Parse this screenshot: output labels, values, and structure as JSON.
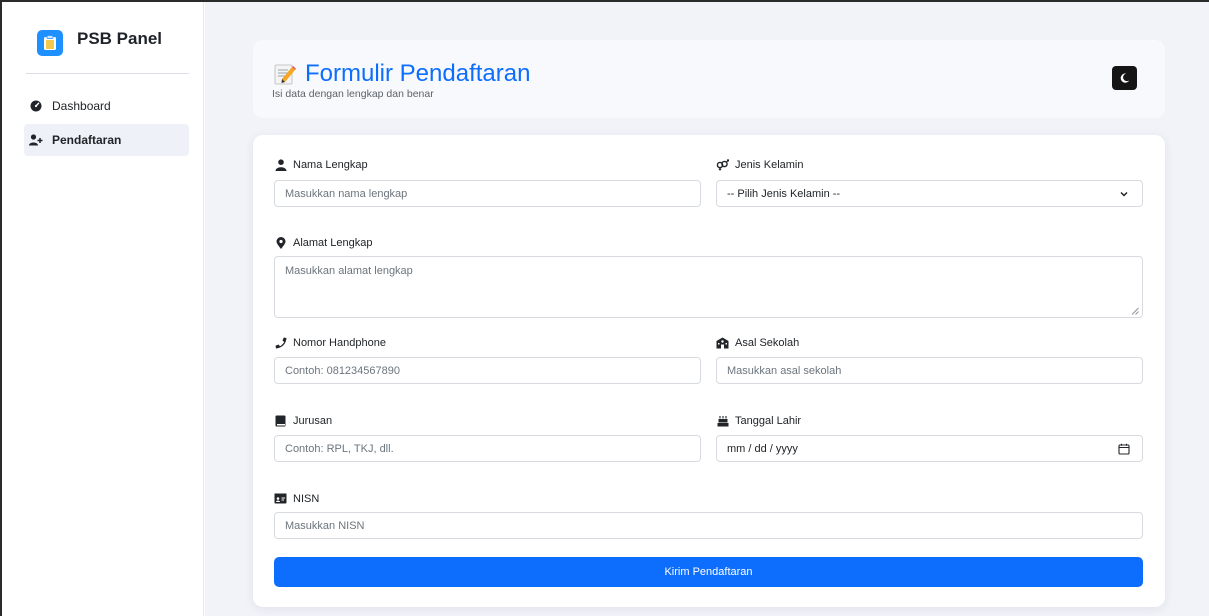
{
  "app": {
    "brand_title": "PSB Panel"
  },
  "sidebar": {
    "items": [
      {
        "label": "Dashboard",
        "icon": "gauge-icon"
      },
      {
        "label": "Pendaftaran",
        "icon": "user-plus-icon"
      }
    ],
    "active_index": 1
  },
  "header": {
    "title": "Formulir Pendaftaran",
    "subtitle": "Isi data dengan lengkap dan benar",
    "theme_toggle_icon": "moon-icon"
  },
  "form": {
    "nama": {
      "label": "Nama Lengkap",
      "placeholder": "Masukkan nama lengkap",
      "icon": "user-icon"
    },
    "jenis_kelamin": {
      "label": "Jenis Kelamin",
      "selected": "-- Pilih Jenis Kelamin --",
      "icon": "venus-mars-icon"
    },
    "alamat": {
      "label": "Alamat Lengkap",
      "placeholder": "Masukkan alamat lengkap",
      "icon": "map-marker-icon"
    },
    "hp": {
      "label": "Nomor Handphone",
      "placeholder": "Contoh: 081234567890",
      "icon": "phone-icon"
    },
    "asal_sekolah": {
      "label": "Asal Sekolah",
      "placeholder": "Masukkan asal sekolah",
      "icon": "school-icon"
    },
    "jurusan": {
      "label": "Jurusan",
      "placeholder": "Contoh: RPL, TKJ, dll.",
      "icon": "book-icon"
    },
    "tanggal_lahir": {
      "label": "Tanggal Lahir",
      "value": "mm / dd / yyyy",
      "icon": "birthday-cake-icon"
    },
    "nisn": {
      "label": "NISN",
      "placeholder": "Masukkan NISN",
      "icon": "id-card-icon"
    },
    "submit_label": "Kirim Pendaftaran"
  },
  "colors": {
    "primary": "#0d6efd",
    "brand_icon": "#1e90ff",
    "background": "#f1f3f9"
  }
}
